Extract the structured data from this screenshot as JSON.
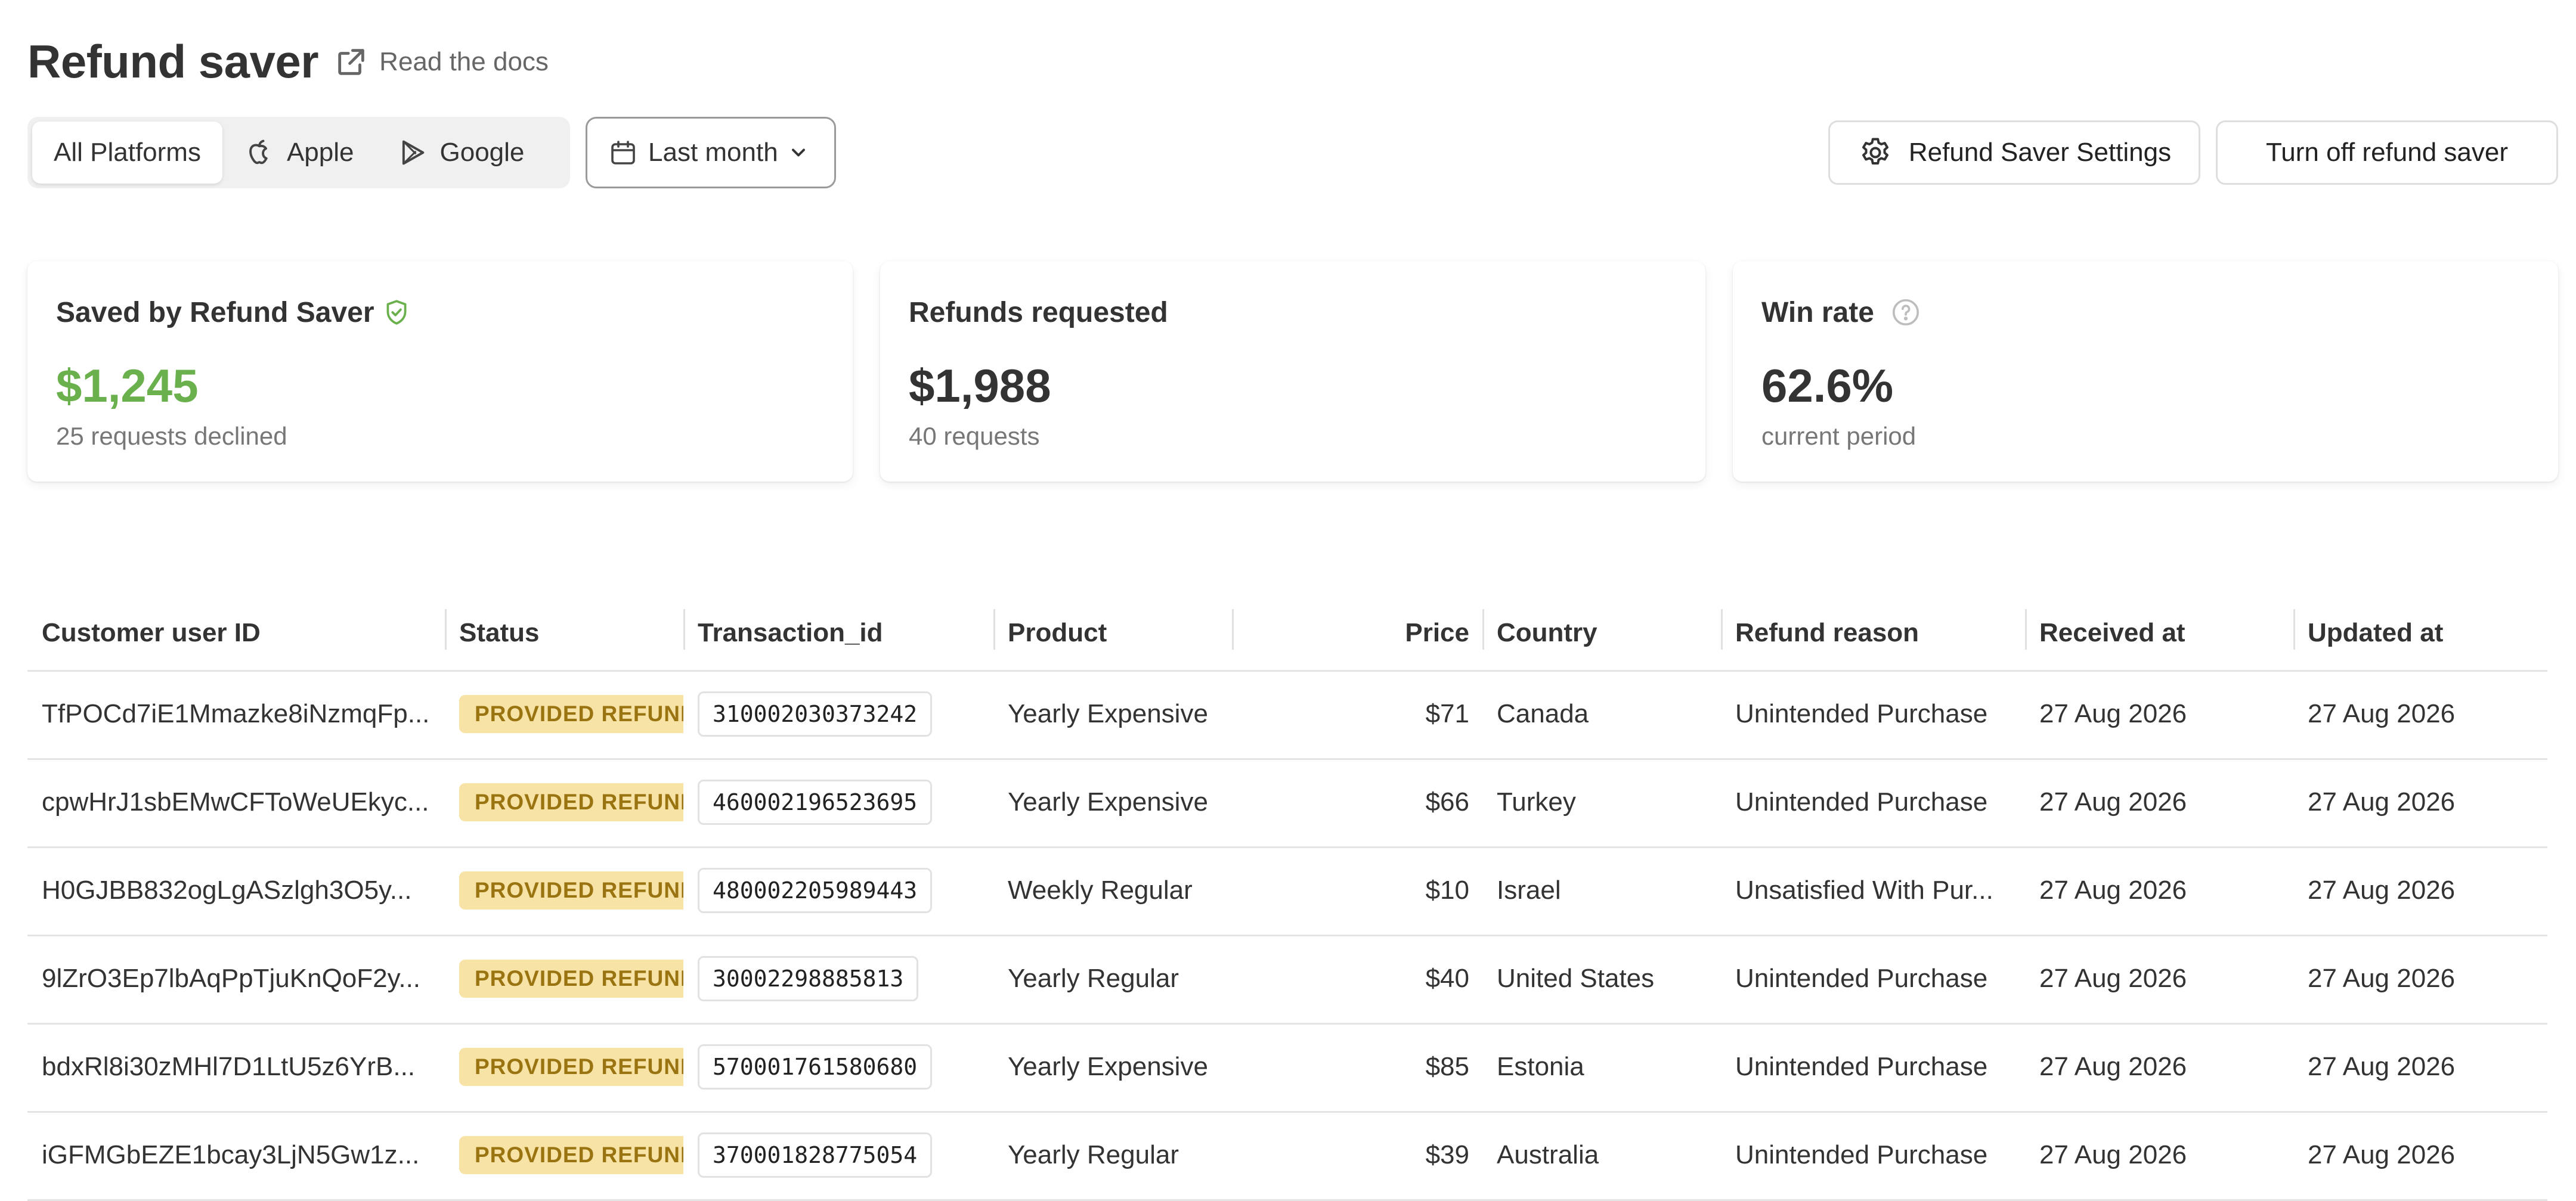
{
  "header": {
    "title": "Refund saver",
    "docs_label": "Read the docs"
  },
  "toolbar": {
    "platforms": [
      {
        "label": "All Platforms",
        "icon": "none",
        "active": true
      },
      {
        "label": "Apple",
        "icon": "apple-icon",
        "active": false
      },
      {
        "label": "Google",
        "icon": "google-play-icon",
        "active": false
      }
    ],
    "date_range": "Last month",
    "settings_label": "Refund Saver Settings",
    "turn_off_label": "Turn off refund saver"
  },
  "cards": [
    {
      "title": "Saved by Refund Saver",
      "value": "$1,245",
      "sub": "25 requests declined",
      "icon": "shield-check-icon",
      "accent": "#6ab04c"
    },
    {
      "title": "Refunds requested",
      "value": "$1,988",
      "sub": "40 requests"
    },
    {
      "title": "Win rate",
      "value": "62.6%",
      "sub": "current period",
      "icon": "help-circle-icon"
    }
  ],
  "table": {
    "columns": [
      "Customer user ID",
      "Status",
      "Transaction_id",
      "Product",
      "Price",
      "Country",
      "Refund reason",
      "Received at",
      "Updated at"
    ],
    "rows": [
      {
        "id": "TfPOCd7iE1Mmazke8iNzmqFp...",
        "status": "PROVIDED REFUND",
        "tx": "310002030373242",
        "product": "Yearly Expensive",
        "price": "$71",
        "country": "Canada",
        "reason": "Unintended Purchase",
        "received": "27 Aug 2026",
        "updated": "27 Aug 2026"
      },
      {
        "id": "cpwHrJ1sbEMwCFToWeUEkyc...",
        "status": "PROVIDED REFUND",
        "tx": "460002196523695",
        "product": "Yearly Expensive",
        "price": "$66",
        "country": "Turkey",
        "reason": "Unintended Purchase",
        "received": "27 Aug 2026",
        "updated": "27 Aug 2026"
      },
      {
        "id": "H0GJBB832ogLgASzlgh3O5y...",
        "status": "PROVIDED REFUND",
        "tx": "480002205989443",
        "product": "Weekly Regular",
        "price": "$10",
        "country": "Israel",
        "reason": "Unsatisfied With Pur...",
        "received": "27 Aug 2026",
        "updated": "27 Aug 2026"
      },
      {
        "id": "9lZrO3Ep7lbAqPpTjuKnQoF2y...",
        "status": "PROVIDED REFUND",
        "tx": "30002298885813",
        "product": "Yearly Regular",
        "price": "$40",
        "country": "United States",
        "reason": "Unintended Purchase",
        "received": "27 Aug 2026",
        "updated": "27 Aug 2026"
      },
      {
        "id": "bdxRl8i30zMHl7D1LtU5z6YrB...",
        "status": "PROVIDED REFUND",
        "tx": "570001761580680",
        "product": "Yearly Expensive",
        "price": "$85",
        "country": "Estonia",
        "reason": "Unintended Purchase",
        "received": "27 Aug 2026",
        "updated": "27 Aug 2026"
      },
      {
        "id": "iGFMGbEZE1bcay3LjN5Gw1z...",
        "status": "PROVIDED REFUND",
        "tx": "370001828775054",
        "product": "Yearly Regular",
        "price": "$39",
        "country": "Australia",
        "reason": "Unintended Purchase",
        "received": "27 Aug 2026",
        "updated": "27 Aug 2026"
      }
    ]
  }
}
